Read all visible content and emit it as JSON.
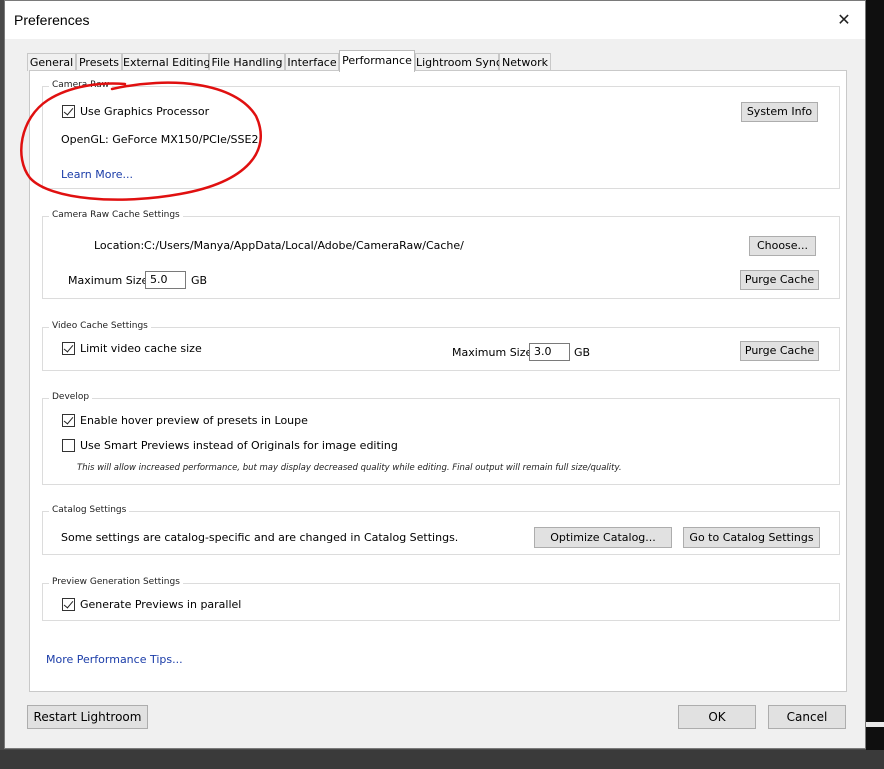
{
  "window": {
    "title": "Preferences",
    "close_glyph": "✕"
  },
  "tabs": [
    {
      "label": "General",
      "active": false
    },
    {
      "label": "Presets",
      "active": false
    },
    {
      "label": "External Editing",
      "active": false
    },
    {
      "label": "File Handling",
      "active": false
    },
    {
      "label": "Interface",
      "active": false
    },
    {
      "label": "Performance",
      "active": true
    },
    {
      "label": "Lightroom Sync",
      "active": false
    },
    {
      "label": "Network",
      "active": false
    }
  ],
  "camera_raw": {
    "label": "Camera Raw",
    "use_gpu_label": "Use Graphics Processor",
    "use_gpu_checked": true,
    "opengl_text": "OpenGL: GeForce MX150/PCIe/SSE2",
    "learn_more": "Learn More...",
    "system_info_button": "System Info"
  },
  "cache": {
    "label": "Camera Raw Cache Settings",
    "location_label": "Location:",
    "location_value": "C:/Users/Manya/AppData/Local/Adobe/CameraRaw/Cache/",
    "choose_button": "Choose...",
    "max_size_label": "Maximum Size:",
    "max_size_value": "5.0",
    "unit": "GB",
    "purge_button": "Purge Cache"
  },
  "video_cache": {
    "label": "Video Cache Settings",
    "limit_label": "Limit video cache size",
    "limit_checked": true,
    "max_size_label": "Maximum Size:",
    "max_size_value": "3.0",
    "unit": "GB",
    "purge_button": "Purge Cache"
  },
  "develop": {
    "label": "Develop",
    "hover_label": "Enable hover preview of presets in Loupe",
    "hover_checked": true,
    "smart_label": "Use Smart Previews instead of Originals for image editing",
    "smart_checked": false,
    "note": "This will allow increased performance, but may display decreased quality while editing. Final output will remain full size/quality."
  },
  "catalog": {
    "label": "Catalog Settings",
    "text": "Some settings are catalog-specific and are changed in Catalog Settings.",
    "optimize_button": "Optimize Catalog...",
    "goto_button": "Go to Catalog Settings"
  },
  "preview": {
    "label": "Preview Generation Settings",
    "parallel_label": "Generate Previews in parallel",
    "parallel_checked": true
  },
  "more_tips": "More Performance Tips...",
  "footer": {
    "restart_button": "Restart Lightroom",
    "ok_button": "OK",
    "cancel_button": "Cancel"
  },
  "annotation": {
    "color": "#e01010",
    "shape": "hand-drawn ellipse"
  }
}
